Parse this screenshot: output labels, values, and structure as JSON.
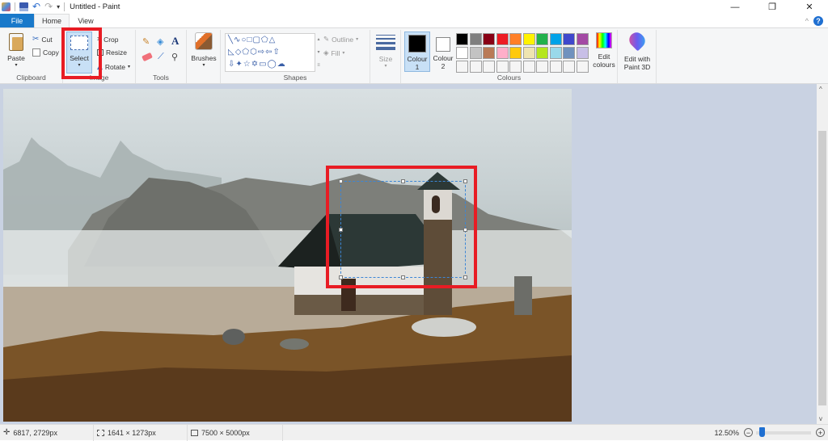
{
  "window": {
    "title": "Untitled - Paint",
    "controls": {
      "minimize": "—",
      "maximize": "❐",
      "close": "✕"
    }
  },
  "tabs": [
    {
      "label": "File",
      "active": false
    },
    {
      "label": "Home",
      "active": true
    },
    {
      "label": "View",
      "active": false
    }
  ],
  "ribbon": {
    "clipboard": {
      "label": "Clipboard",
      "paste": "Paste",
      "cut": "Cut",
      "copy": "Copy"
    },
    "image": {
      "label": "Image",
      "select": "Select",
      "crop": "Crop",
      "resize": "Resize",
      "rotate": "Rotate"
    },
    "tools": {
      "label": "Tools"
    },
    "brushes": {
      "label": "Brushes"
    },
    "shapes": {
      "label": "Shapes",
      "outline": "Outline",
      "fill": "Fill"
    },
    "size": {
      "label": "Size"
    },
    "colours": {
      "label": "Colours",
      "colour1": "Colour\n1",
      "colour1_a": "Colour",
      "colour1_b": "1",
      "colour2_a": "Colour",
      "colour2_b": "2",
      "colour1_value": "#000000",
      "colour2_value": "#ffffff",
      "palette_row1": [
        "#000000",
        "#7f7f7f",
        "#880015",
        "#ed1c24",
        "#ff7f27",
        "#fff200",
        "#22b14c",
        "#00a2e8",
        "#3f48cc",
        "#a349a4"
      ],
      "palette_row2": [
        "#ffffff",
        "#c3c3c3",
        "#b97a57",
        "#ffaec9",
        "#ffc90e",
        "#efe4b0",
        "#b5e61d",
        "#99d9ea",
        "#7092be",
        "#c8bfe7"
      ],
      "palette_row3": [
        "#f5f5f5",
        "#f5f5f5",
        "#f5f5f5",
        "#f5f5f5",
        "#f5f5f5",
        "#f5f5f5",
        "#f5f5f5",
        "#f5f5f5",
        "#f5f5f5",
        "#f5f5f5"
      ],
      "edit_a": "Edit",
      "edit_b": "colours"
    },
    "paint3d": {
      "a": "Edit with",
      "b": "Paint 3D"
    }
  },
  "status": {
    "cursor": "6817, 2729px",
    "selection": "1641 × 1273px",
    "image_size": "7500 × 5000px",
    "zoom": "12.50%",
    "zoom_fraction": 0.06
  },
  "annotations": {
    "highlight_color": "#e81c24"
  }
}
